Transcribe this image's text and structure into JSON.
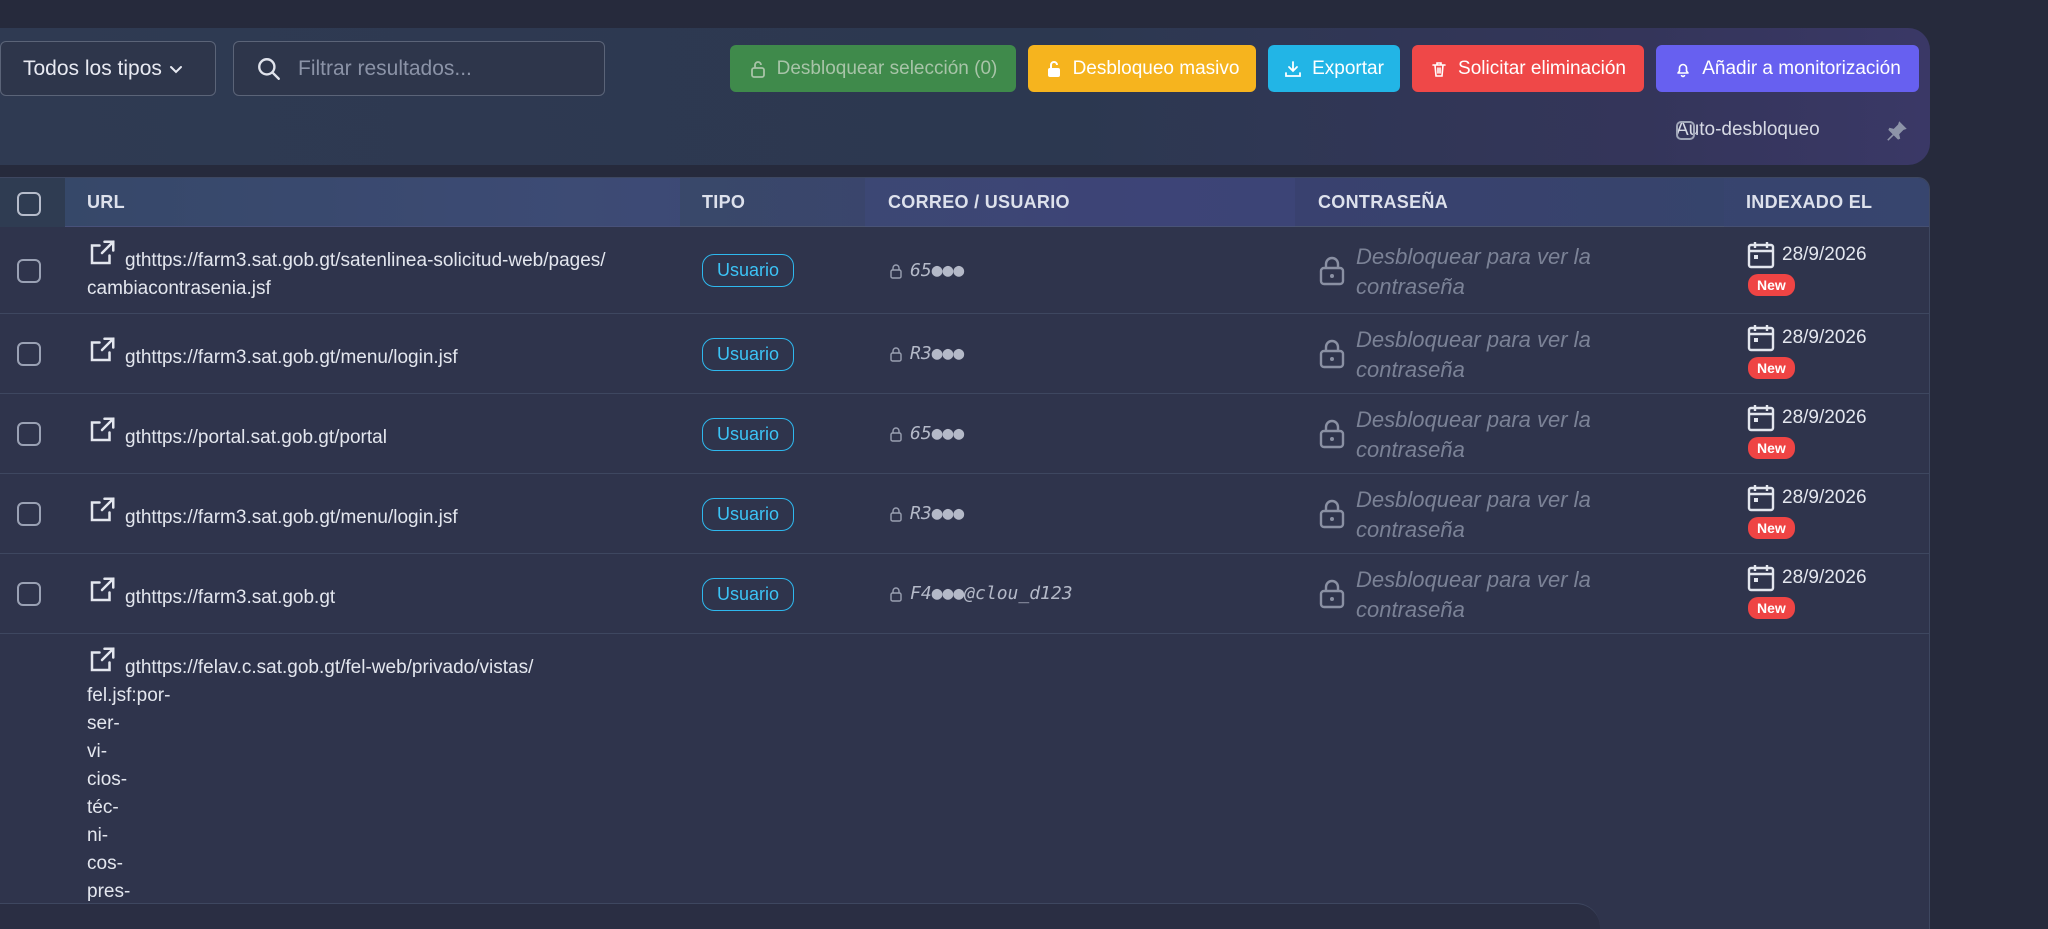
{
  "toolbar": {
    "type_select": {
      "value": "Todos los tipos"
    },
    "search": {
      "placeholder": "Filtrar resultados..."
    },
    "buttons": {
      "unlock_selection": "Desbloquear selección (0)",
      "mass_unlock": "Desbloqueo masivo",
      "export": "Exportar",
      "request_delete": "Solicitar eliminación",
      "add_monitor": "Añadir a monitorización"
    },
    "auto_unlock_label": "Auto-desbloqueo",
    "colors": {
      "unlock_selection": "#3f8a4b",
      "mass_unlock": "#f6b41e",
      "export": "#22b5e6",
      "request_delete": "#ef4848",
      "add_monitor": "#6760f0"
    }
  },
  "table": {
    "headers": {
      "url": "URL",
      "type": "TIPO",
      "user": "CORREO / USUARIO",
      "password": "CONTRASEÑA",
      "indexed": "INDEXADO EL"
    },
    "rows": [
      {
        "url": "gthttps://farm3.sat.gob.gt/satenlinea-solicitud-web/pages/",
        "url2": "cambiacontrasenia.jsf",
        "type": "Usuario",
        "user": "65●●●",
        "password": "Desbloquear para ver la contraseña",
        "date": "28/9/2026",
        "badge": "New"
      },
      {
        "url": "gthttps://farm3.sat.gob.gt/menu/login.jsf",
        "type": "Usuario",
        "user": "R3●●●",
        "password": "Desbloquear para ver la contraseña",
        "date": "28/9/2026",
        "badge": "New"
      },
      {
        "url": "gthttps://portal.sat.gob.gt/portal",
        "type": "Usuario",
        "user": "65●●●",
        "password": "Desbloquear para ver la contraseña",
        "date": "28/9/2026",
        "badge": "New"
      },
      {
        "url": "gthttps://farm3.sat.gob.gt/menu/login.jsf",
        "type": "Usuario",
        "user": "R3●●●",
        "password": "Desbloquear para ver la contraseña",
        "date": "28/9/2026",
        "badge": "New"
      },
      {
        "url": "gthttps://farm3.sat.gob.gt",
        "type": "Usuario",
        "user": "F4●●●@clou_d123",
        "password": "Desbloquear para ver la contraseña",
        "date": "28/9/2026",
        "badge": "New"
      },
      {
        "url": "gthttps://felav.c.sat.gob.gt/fel-web/privado/vistas/",
        "url_lines": [
          "fel.jsf:por-",
          "ser-",
          "vi-",
          "cios-",
          "téc-",
          "ni-",
          "cos-",
          "pres-"
        ]
      }
    ]
  }
}
